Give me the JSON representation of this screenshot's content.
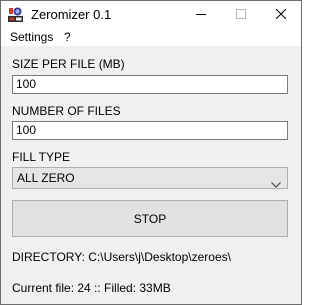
{
  "window": {
    "title": "Zeromizer 0.1"
  },
  "menu": {
    "settings": "Settings",
    "help": "?"
  },
  "form": {
    "size_label": "SIZE PER FILE (MB)",
    "size_value": "100",
    "count_label": "NUMBER OF FILES",
    "count_value": "100",
    "fill_label": "FILL TYPE",
    "fill_value": "ALL ZERO",
    "stop_label": "STOP"
  },
  "status": {
    "directory": "DIRECTORY: C:\\Users\\j\\Desktop\\zeroes\\",
    "progress": "Current file: 24 :: Filled: 33MB"
  },
  "icons": {
    "app": "zeromizer-app-icon",
    "minimize": "minimize-icon",
    "maximize": "maximize-icon",
    "close": "close-icon",
    "dropdown": "chevron-down-icon"
  }
}
